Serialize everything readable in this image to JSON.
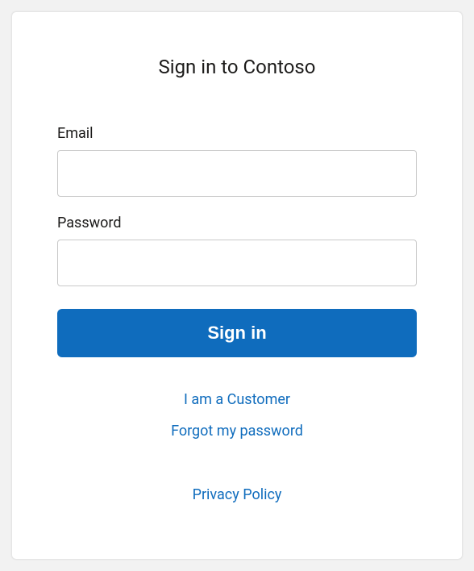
{
  "title": "Sign in to Contoso",
  "fields": {
    "email_label": "Email",
    "email_value": "",
    "password_label": "Password",
    "password_value": ""
  },
  "actions": {
    "signin_label": "Sign in"
  },
  "links": {
    "customer": "I am a Customer",
    "forgot_password": "Forgot my password",
    "privacy": "Privacy Policy"
  }
}
